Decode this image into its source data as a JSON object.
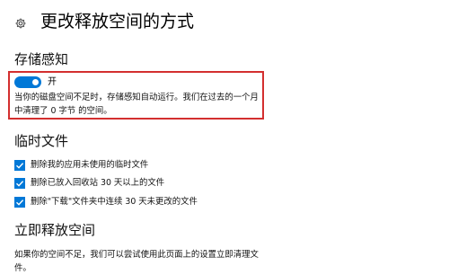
{
  "header": {
    "title": "更改释放空间的方式",
    "icon": "gear-icon"
  },
  "storage_sense": {
    "title": "存储感知",
    "toggle_state": true,
    "toggle_label": "开",
    "description_line1": "当你的磁盘空间不足时，存储感知自动运行。我们在过去的一个月",
    "description_line2": "中清理了 0 字节 的空间。",
    "highlight_color": "#d32f2f"
  },
  "temp_files": {
    "title": "临时文件",
    "options": [
      {
        "label": "删除我的应用未使用的临时文件",
        "checked": true
      },
      {
        "label": "删除已放入回收站 30 天以上的文件",
        "checked": true
      },
      {
        "label": "删除\"下载\"文件夹中连续 30 天未更改的文件",
        "checked": true
      }
    ]
  },
  "free_now": {
    "title": "立即释放空间",
    "description": "如果你的空间不足，我们可以尝试使用此页面上的设置立即清理文件。"
  },
  "colors": {
    "accent": "#0078d7",
    "highlight": "#d32f2f"
  }
}
